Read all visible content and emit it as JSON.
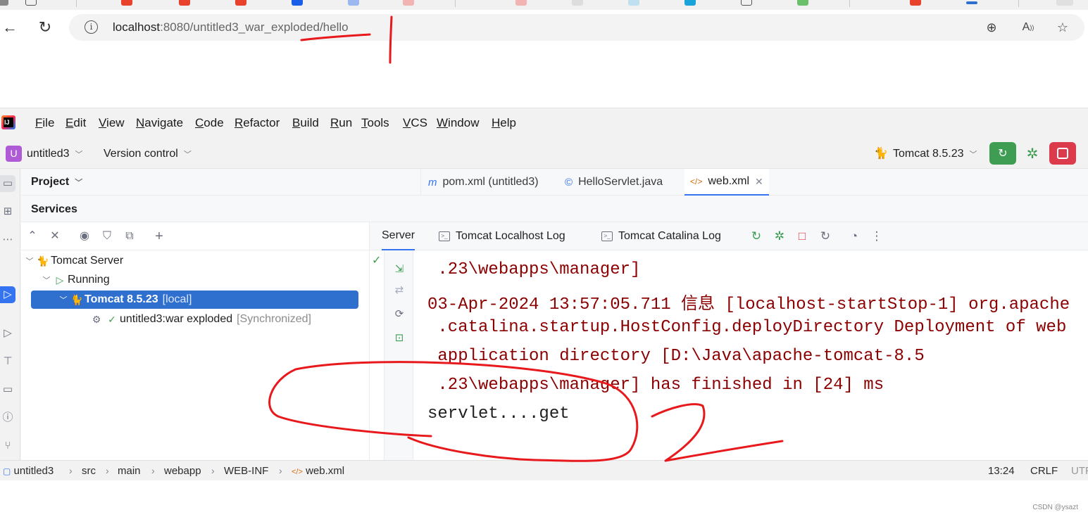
{
  "browser": {
    "url_host": "localhost",
    "url_path": ":8080/untitled3_war_exploded/hello",
    "icons": [
      "back-icon",
      "reload-icon",
      "site-info-icon",
      "zoom-icon",
      "read-aloud-icon",
      "favorite-star-icon"
    ]
  },
  "ide": {
    "menu": [
      "File",
      "Edit",
      "View",
      "Navigate",
      "Code",
      "Refactor",
      "Build",
      "Run",
      "Tools",
      "VCS",
      "Window",
      "Help"
    ],
    "project_badge": "U",
    "project_name": "untitled3",
    "version_control": "Version control",
    "run_config": "Tomcat 8.5.23",
    "project_panel_title": "Project",
    "editor_tabs": [
      {
        "label": "pom.xml (untitled3)",
        "icon": "m"
      },
      {
        "label": "HelloServlet.java",
        "icon": "©"
      },
      {
        "label": "web.xml",
        "icon": "</>"
      }
    ],
    "services_title": "Services",
    "tree": [
      {
        "label": "Tomcat Server",
        "extra": ""
      },
      {
        "label": "Running",
        "extra": ""
      },
      {
        "label": "Tomcat 8.5.23",
        "extra": "[local]"
      },
      {
        "label": "untitled3:war exploded",
        "extra": "[Synchronized]"
      }
    ],
    "console_tabs": [
      "Server",
      "Tomcat Localhost Log",
      "Tomcat Catalina Log"
    ],
    "console_lines": [
      " .23\\webapps\\manager]",
      "03-Apr-2024 13:57:05.711 信息 [localhost-startStop-1] org.apache",
      " .catalina.startup.HostConfig.deployDirectory Deployment of web",
      " application directory [D:\\Java\\apache-tomcat-8.5",
      " .23\\webapps\\manager] has finished in [24] ms",
      "servlet....get"
    ],
    "breadcrumbs": [
      "untitled3",
      "src",
      "main",
      "webapp",
      "WEB-INF",
      "web.xml"
    ],
    "status_position": "13:24",
    "status_line_sep": "CRLF",
    "status_encoding": "UTF"
  },
  "watermark": "CSDN @ysazt",
  "colors": {
    "accent": "#3574f0",
    "run_green": "#3e9d52",
    "stop_red": "#db3b4b",
    "console_red": "#8b0000",
    "annotation_red": "#e8191c"
  }
}
